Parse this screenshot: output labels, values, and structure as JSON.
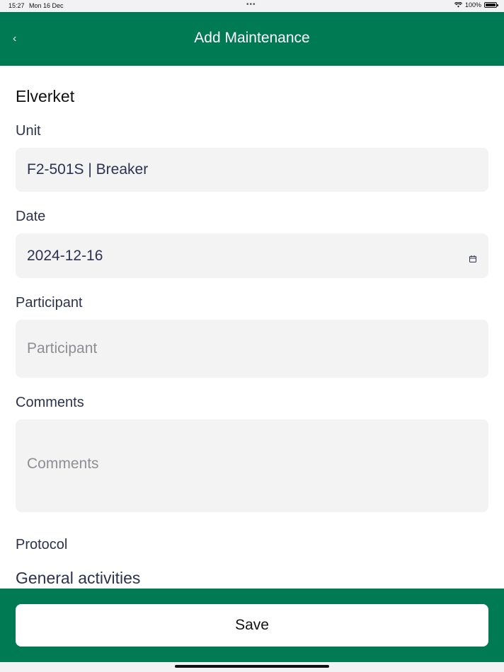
{
  "status_bar": {
    "time": "15:27",
    "date": "Mon 16 Dec",
    "dots": "•••",
    "battery": "100%"
  },
  "nav": {
    "back_glyph": "‹",
    "title": "Add Maintenance"
  },
  "form": {
    "site_name": "Elverket",
    "unit_label": "Unit",
    "unit_value": "F2-501S | Breaker",
    "date_label": "Date",
    "date_value": "2024-12-16",
    "participant_label": "Participant",
    "participant_placeholder": "Participant",
    "comments_label": "Comments",
    "comments_placeholder": "Comments",
    "protocol_label": "Protocol",
    "general_activities": "General activities"
  },
  "footer": {
    "save_label": "Save"
  },
  "colors": {
    "brand_green": "#007a52",
    "field_bg": "#f3f3f3",
    "label_text": "#2c3250"
  }
}
